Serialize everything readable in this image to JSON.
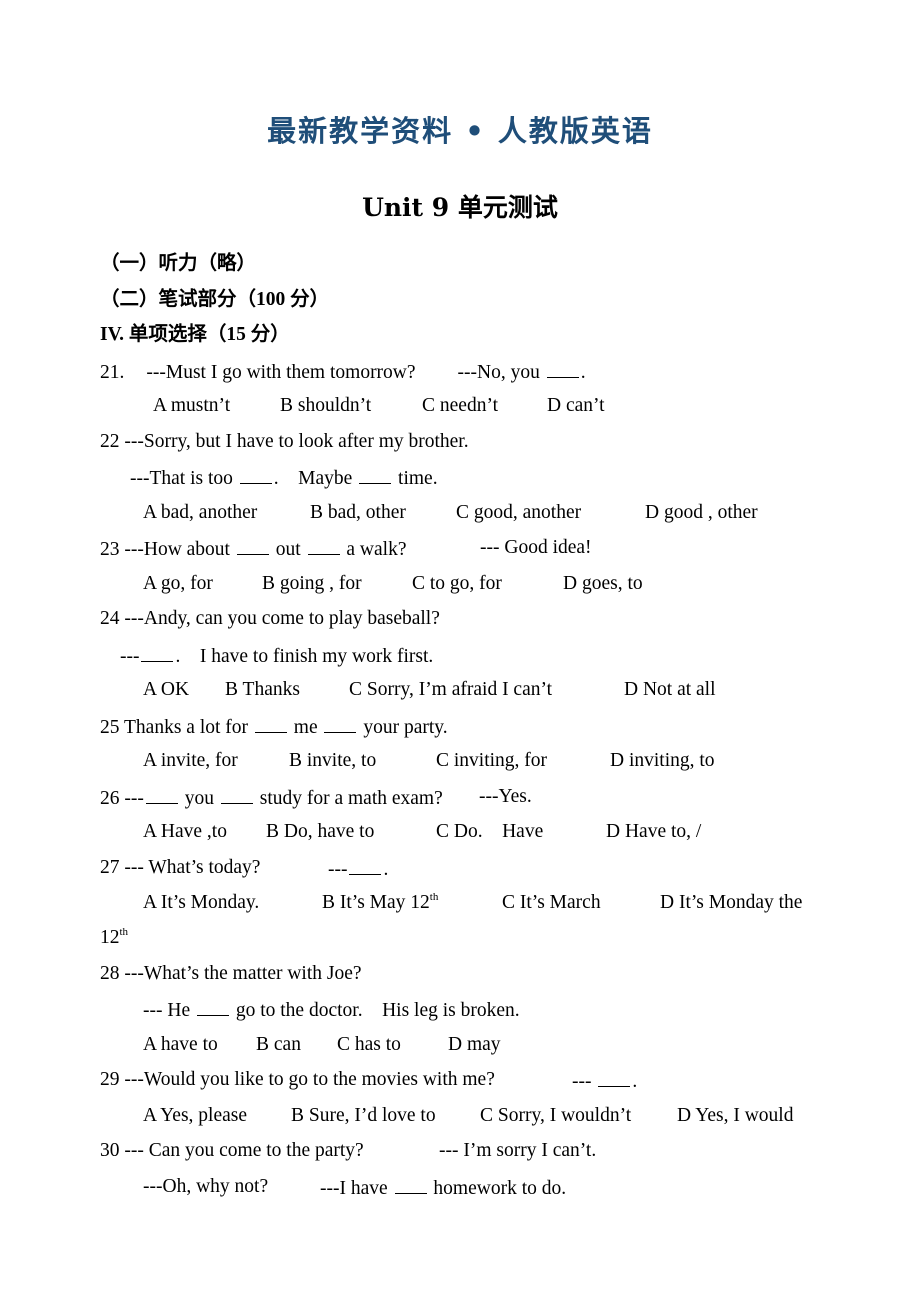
{
  "header": {
    "banner": "最新教学资料 • 人教版英语",
    "title": "Unit 9  单元测试"
  },
  "sections": {
    "listening": "（一）听力（略）",
    "written": "（二）笔试部分（100 分）",
    "part4": "IV. 单项选择（15 分）"
  },
  "questions": [
    {
      "number": "21.",
      "lines": [
        "---Must I go with them tomorrow?",
        "---No, you ___."
      ],
      "options": [
        "A mustn’t",
        "B shouldn’t",
        "C needn’t",
        "D can’t"
      ]
    },
    {
      "number": "22",
      "lines": [
        "---Sorry, but I have to look after my brother.",
        "---That is too ___.    Maybe ___ time."
      ],
      "options": [
        "A bad, another",
        "B bad, other",
        "C good, another",
        "D good , other"
      ]
    },
    {
      "number": "23",
      "lines": [
        "---How about ___ out ___ a walk?",
        "--- Good idea!"
      ],
      "options": [
        "A go, for",
        "B going , for",
        "C to go, for",
        "D goes, to"
      ]
    },
    {
      "number": "24",
      "lines": [
        "---Andy, can you come to play baseball?",
        "---___.    I have to finish my work first."
      ],
      "options": [
        "A OK",
        "B Thanks",
        "C Sorry, I’m afraid I can’t",
        "D Not at all"
      ]
    },
    {
      "number": "25",
      "lines": [
        "Thanks a lot for ___ me ___ your party."
      ],
      "options": [
        "A invite, for",
        "B invite, to",
        "C inviting, for",
        "D inviting, to"
      ]
    },
    {
      "number": "26",
      "lines": [
        "---___ you ___ study for a math exam?",
        "---Yes."
      ],
      "options": [
        "A Have ,to",
        "B Do, have to",
        "C Do.    Have",
        "D Have to, /"
      ]
    },
    {
      "number": "27",
      "lines": [
        "--- What’s today?",
        "---___."
      ],
      "options": [
        "A It’s Monday.",
        "B It’s May 12th",
        "C It’s March",
        "D It’s Monday the 12th"
      ]
    },
    {
      "number": "28",
      "lines": [
        "---What’s the matter with Joe?",
        "--- He ___ go to the doctor.    His leg is broken."
      ],
      "options": [
        "A have to",
        "B can",
        "C has to",
        "D may"
      ]
    },
    {
      "number": "29",
      "lines": [
        "---Would you like to go to the movies with me?",
        "--- ___."
      ],
      "options": [
        "A Yes, please",
        "B Sure, I’d love to",
        "C Sorry, I wouldn’t",
        "D Yes, I would"
      ]
    },
    {
      "number": "30",
      "lines": [
        "--- Can you come to the party?",
        "--- I’m sorry I can’t.",
        "---Oh, why not?",
        "---I have ___ homework to do."
      ],
      "options": []
    }
  ],
  "text": {
    "q21_num": "21.",
    "q21_a": "---Must I go with them tomorrow?",
    "q21_b1": "---No, you ",
    "q21_b2": ".",
    "q21_opts": [
      "A mustn’t",
      "B shouldn’t",
      "C needn’t",
      "D can’t"
    ],
    "q22_a": "22 ---Sorry, but I have to look after my brother.",
    "q22_b1": "---That is too ",
    "q22_b2": ".    Maybe ",
    "q22_b3": " time.",
    "q22_opts": [
      "A bad, another",
      "B bad, other",
      "C good, another",
      "D good , other"
    ],
    "q23_a1": "23 ---How about ",
    "q23_a2": " out ",
    "q23_a3": " a walk?",
    "q23_b": "--- Good idea!",
    "q23_opts": [
      "A go, for",
      "B going , for",
      "C to go, for",
      "D goes, to"
    ],
    "q24_a": "24 ---Andy, can you come to play baseball?",
    "q24_b1": "---",
    "q24_b2": ".    I have to finish my work first.",
    "q24_opts": [
      "A OK",
      "B Thanks",
      "C Sorry, I’m afraid I can’t",
      "D Not at all"
    ],
    "q25_a1": "25 Thanks a lot for ",
    "q25_a2": " me ",
    "q25_a3": " your party.",
    "q25_opts": [
      "A invite, for",
      "B invite, to",
      "C inviting, for",
      "D inviting, to"
    ],
    "q26_a1": "26 ---",
    "q26_a2": " you ",
    "q26_a3": " study for a math exam?",
    "q26_b": "---Yes.",
    "q26_opts": [
      "A Have ,to",
      "B Do, have to",
      "C Do.    Have",
      "D Have to, /"
    ],
    "q27_a": "27 --- What’s today?",
    "q27_b1": "---",
    "q27_b2": ".",
    "q27_optA": "A It’s Monday.",
    "q27_optB": "B It’s May 12",
    "q27_optC": "C It’s March",
    "q27_optD": "D It’s Monday the",
    "q27_cont": "12",
    "sup_th": "th",
    "q28_a": "28 ---What’s the matter with Joe?",
    "q28_b1": "--- He ",
    "q28_b2": " go to the doctor.    His leg is broken.",
    "q28_opts": [
      "A have to",
      "B can",
      "C has to",
      "D may"
    ],
    "q29_a": "29 ---Would you like to go to the movies with me?",
    "q29_b": "--- ",
    "q29_c": ".",
    "q29_opts": [
      "A Yes, please",
      "B Sure, I’d love to",
      "C Sorry, I wouldn’t",
      "D Yes, I would"
    ],
    "q30_a": "30 --- Can you come to the party?",
    "q30_b": "--- I’m sorry I can’t.",
    "q30_c": "---Oh, why not?",
    "q30_d1": "---I have ",
    "q30_d2": " homework to do."
  }
}
